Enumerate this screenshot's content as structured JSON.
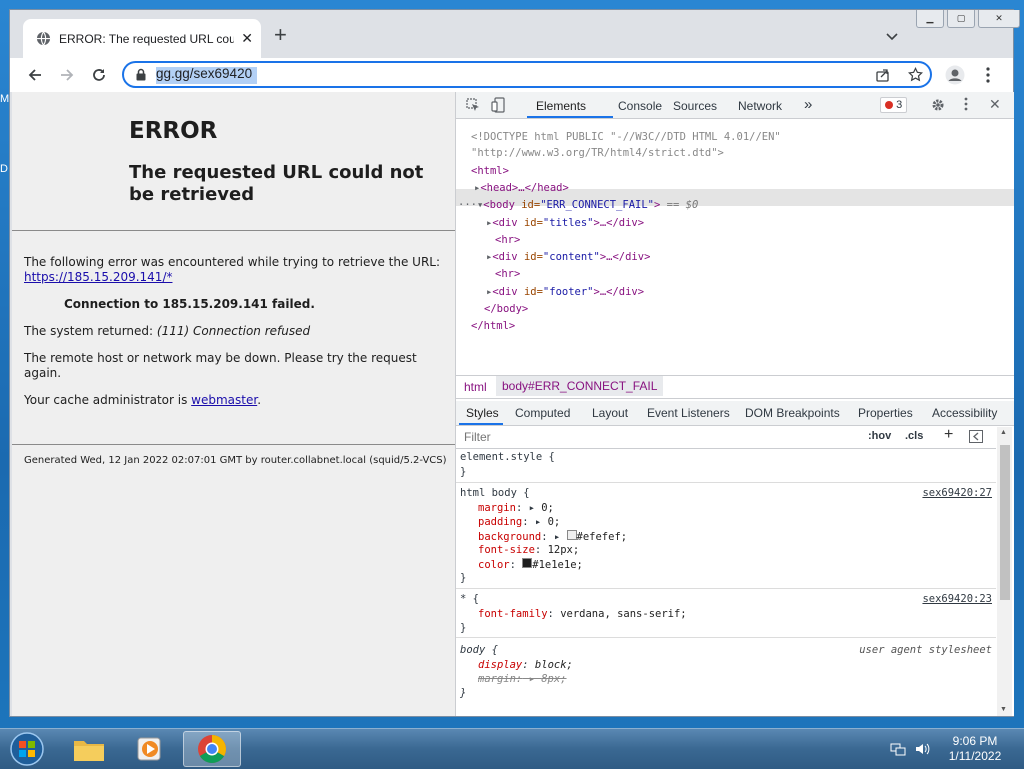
{
  "desktop": {
    "letters": [
      "M",
      "D"
    ]
  },
  "browser": {
    "tab_title": "ERROR: The requested URL could",
    "address": "gg.gg/sex69420"
  },
  "page": {
    "heading": "ERROR",
    "subheading": "The requested URL could not be retrieved",
    "intro": "The following error was encountered while trying to retrieve the URL:",
    "url_link": "https://185.15.209.141/*",
    "failure": "Connection to 185.15.209.141 failed.",
    "system_returned_label": "The system returned:",
    "system_returned_value": "(111) Connection refused",
    "remote_down": "The remote host or network may be down. Please try the request again.",
    "admin_label": "Your cache administrator is",
    "admin_link": "webmaster",
    "admin_end": ".",
    "footer": "Generated Wed, 12 Jan 2022 02:07:01 GMT by router.collabnet.local (squid/5.2-VCS)"
  },
  "devtools": {
    "tabs": [
      "Elements",
      "Console",
      "Sources",
      "Network"
    ],
    "more": "»",
    "error_count": "3",
    "dom": {
      "doctype1": "<!DOCTYPE html PUBLIC \"-//W3C//DTD HTML 4.01//EN\"",
      "doctype2": "\"http://www.w3.org/TR/html4/strict.dtd\">",
      "html_open": "<html>",
      "head": "<head>…</head>",
      "body_open_tag": "<body",
      "body_attr": " id=",
      "body_val": "\"ERR_CONNECT_FAIL\"",
      "body_close": ">",
      "selected_marker": "== $0",
      "ellipsis": "···",
      "div_titles_open": "<div",
      "div_titles_attr": " id=",
      "div_titles_val": "\"titles\"",
      "div_titles_close": ">…</div>",
      "hr": "<hr>",
      "div_content_val": "\"content\"",
      "div_footer_val": "\"footer\"",
      "body_end": "</body>",
      "html_end": "</html>"
    },
    "breadcrumb": [
      "html",
      "body#ERR_CONNECT_FAIL"
    ],
    "subtabs": [
      "Styles",
      "Computed",
      "Layout",
      "Event Listeners",
      "DOM Breakpoints",
      "Properties",
      "Accessibility"
    ],
    "filter_placeholder": "Filter",
    "hov": ":hov",
    "cls": ".cls",
    "rules": {
      "element_style": "element.style {",
      "close_brace": "}",
      "html_body_sel": "html body {",
      "html_body_src": "sex69420:27",
      "margin": "margin",
      "margin_val": "0;",
      "padding": "padding",
      "padding_val": "0;",
      "background": "background",
      "background_val": "#efefef;",
      "font_size": "font-size",
      "font_size_val": "12px;",
      "color": "color",
      "color_val": "#1e1e1e;",
      "star_sel": "* {",
      "star_src": "sex69420:23",
      "font_family": "font-family",
      "font_family_val": "verdana, sans-serif;",
      "body_sel": "body {",
      "body_src": "user agent stylesheet",
      "display": "display",
      "display_val": "block;",
      "ua_margin": "margin:",
      "ua_margin_val": "8px;"
    }
  },
  "taskbar": {
    "time": "9:06 PM",
    "date": "1/11/2022"
  },
  "colors": {
    "accent": "#1a73e8",
    "bg_swatch": "#efefef",
    "fg_swatch": "#1e1e1e"
  }
}
